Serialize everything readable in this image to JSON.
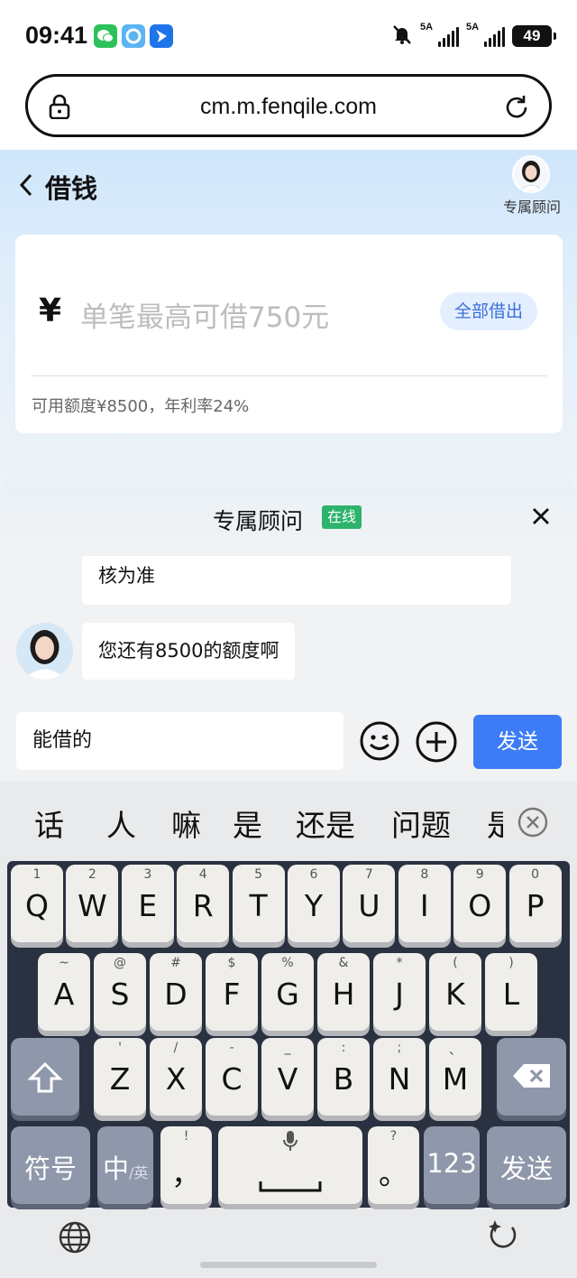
{
  "status_bar": {
    "time": "09:41",
    "net1": "5A",
    "net2": "5A",
    "battery": "49"
  },
  "browser": {
    "url": "cm.m.fenqile.com"
  },
  "page": {
    "title": "借钱",
    "advisor_label": "专属顾问",
    "currency_symbol": "¥",
    "amount_placeholder": "单笔最高可借750元",
    "borrow_all_label": "全部借出",
    "credit_info": "可用额度¥8500，年利率24%"
  },
  "chat": {
    "title": "专属顾问",
    "status": "在线",
    "messages": [
      {
        "text": "核为准"
      },
      {
        "text": "您还有8500的额度啊"
      }
    ],
    "input_value": "能借的",
    "send_label": "发送"
  },
  "keyboard": {
    "candidates": [
      "话",
      "人",
      "嘛",
      "是",
      "还是",
      "问题",
      "是"
    ],
    "row1": [
      {
        "k": "Q",
        "h": "1"
      },
      {
        "k": "W",
        "h": "2"
      },
      {
        "k": "E",
        "h": "3"
      },
      {
        "k": "R",
        "h": "4"
      },
      {
        "k": "T",
        "h": "5"
      },
      {
        "k": "Y",
        "h": "6"
      },
      {
        "k": "U",
        "h": "7"
      },
      {
        "k": "I",
        "h": "8"
      },
      {
        "k": "O",
        "h": "9"
      },
      {
        "k": "P",
        "h": "0"
      }
    ],
    "row2": [
      {
        "k": "A",
        "h": "~"
      },
      {
        "k": "S",
        "h": "@"
      },
      {
        "k": "D",
        "h": "#"
      },
      {
        "k": "F",
        "h": "$"
      },
      {
        "k": "G",
        "h": "%"
      },
      {
        "k": "H",
        "h": "&"
      },
      {
        "k": "J",
        "h": "*"
      },
      {
        "k": "K",
        "h": "("
      },
      {
        "k": "L",
        "h": ")"
      }
    ],
    "row3": [
      {
        "k": "Z",
        "h": "'"
      },
      {
        "k": "X",
        "h": "/"
      },
      {
        "k": "C",
        "h": "-"
      },
      {
        "k": "V",
        "h": "_"
      },
      {
        "k": "B",
        "h": ":"
      },
      {
        "k": "N",
        "h": ";"
      },
      {
        "k": "M",
        "h": "、"
      }
    ],
    "symbols_label": "符号",
    "lang_label": "中",
    "lang_sub": "/英",
    "comma": "，",
    "comma_hint": "!",
    "period": "。",
    "period_hint": "?",
    "num_label": "123",
    "send_label": "发送"
  }
}
